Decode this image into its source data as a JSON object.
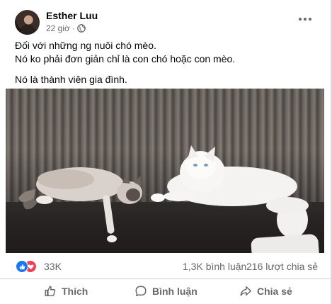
{
  "post": {
    "author": "Esther Luu",
    "time": "22 giờ",
    "separator": "·",
    "audience_icon": "globe-icon",
    "more_icon": "more-horizontal-icon",
    "text_lines": [
      "Đối với những ng nuôi chó mèo.",
      "Nó ko phải đơn giản chỉ là con chó hoặc con mèo.",
      "Nó là thành viên gia đình."
    ],
    "photo_icon": "cats-on-sofa-photo"
  },
  "stats": {
    "reaction_icons": [
      "like-reaction-icon",
      "love-reaction-icon"
    ],
    "reactions_count": "33K",
    "comments": "1,3K bình luận",
    "shares": "216 lượt chia sẻ"
  },
  "actions": {
    "like_label": "Thích",
    "comment_label": "Bình luận",
    "share_label": "Chia sẻ"
  },
  "colors": {
    "text_primary": "#050505",
    "text_secondary": "#65676b",
    "like_blue": "#1877f2",
    "love_red": "#f33e58",
    "divider": "#ced0d4"
  }
}
